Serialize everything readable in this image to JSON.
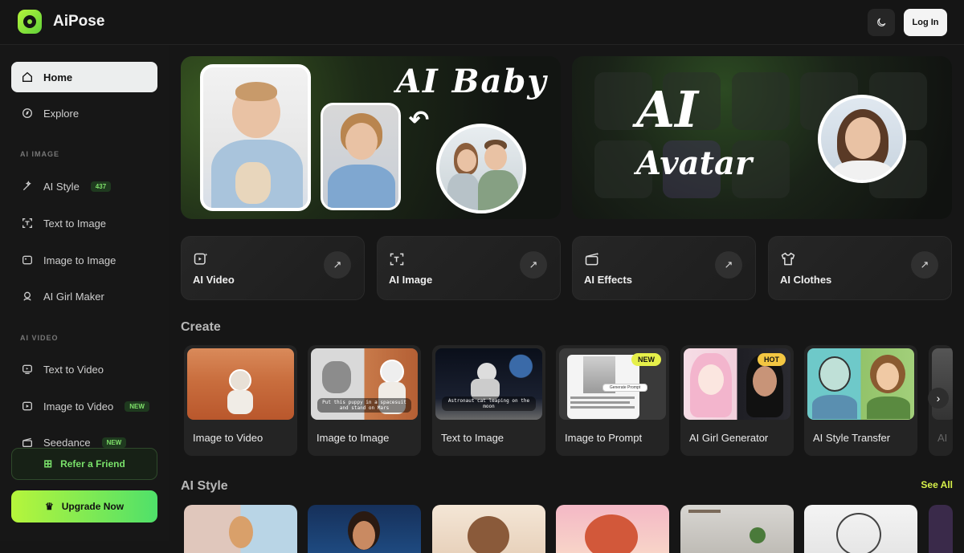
{
  "header": {
    "brand": "AiPose",
    "login_label": "Log In"
  },
  "sidebar": {
    "items": [
      {
        "label": "Home"
      },
      {
        "label": "Explore"
      },
      {
        "label": "AI Style",
        "badge": "437"
      },
      {
        "label": "Text to Image"
      },
      {
        "label": "Image to Image"
      },
      {
        "label": "AI Girl Maker"
      },
      {
        "label": "Text to Video"
      },
      {
        "label": "Image to Video",
        "badge": "NEW"
      },
      {
        "label": "Seedance",
        "badge": "NEW"
      }
    ],
    "section_ai_image": "AI IMAGE",
    "section_ai_video": "AI VIDEO",
    "refer_label": "Refer a Friend",
    "upgrade_label": "Upgrade Now"
  },
  "banners": {
    "baby_title": "AI Baby",
    "avatar_title_1": "AI",
    "avatar_title_2": "Avatar"
  },
  "quick_actions": [
    {
      "label": "AI Video",
      "icon": "video-sparkle-icon"
    },
    {
      "label": "AI Image",
      "icon": "image-scan-icon"
    },
    {
      "label": "AI Effects",
      "icon": "clapper-icon"
    },
    {
      "label": "AI Clothes",
      "icon": "shirt-icon"
    }
  ],
  "create": {
    "title": "Create",
    "cards": [
      {
        "label": "Image to Video"
      },
      {
        "label": "Image to Image",
        "caption": "Put this puppy in a spacesuit and stand on Mars"
      },
      {
        "label": "Text to Image",
        "caption": "Astronaut cat leaping on the moon"
      },
      {
        "label": "Image to Prompt",
        "tag": "NEW",
        "prompt_chip": "Generate Prompt"
      },
      {
        "label": "AI Girl Generator",
        "tag": "HOT"
      },
      {
        "label": "AI Style Transfer"
      },
      {
        "label": "AI"
      }
    ]
  },
  "ai_style": {
    "title": "AI Style",
    "see_all": "See All"
  }
}
